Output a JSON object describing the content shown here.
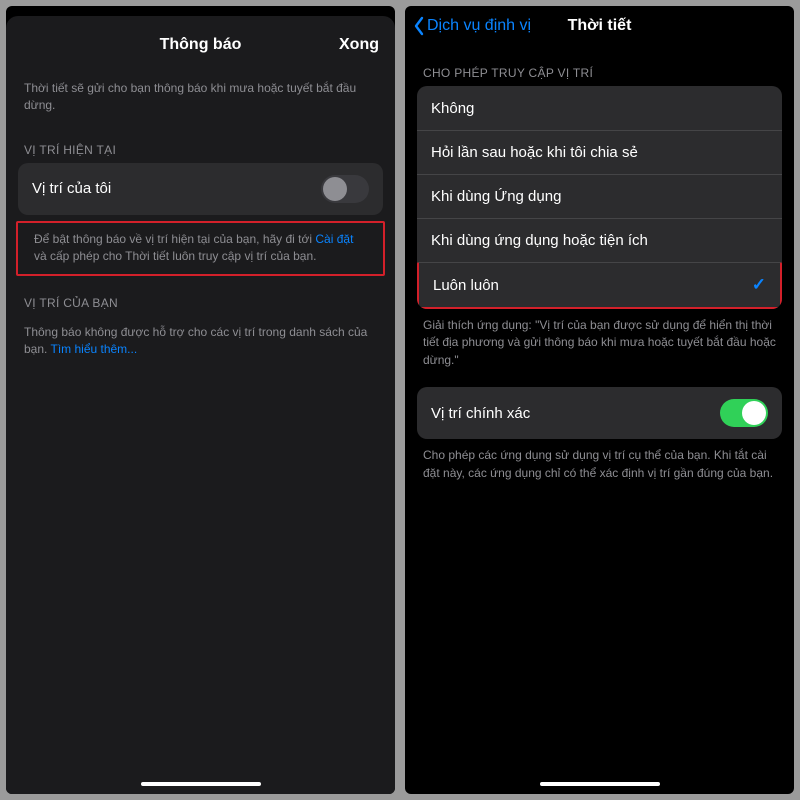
{
  "left": {
    "header": {
      "title": "Thông báo",
      "done": "Xong"
    },
    "intro": "Thời tiết sẽ gửi cho bạn thông báo khi mưa hoặc tuyết bắt đầu dừng.",
    "section_current": "VỊ TRÍ HIỆN TẠI",
    "my_location_label": "Vị trí của tôi",
    "hint_pre": "Để bật thông báo về vị trí hiện tại của bạn, hãy đi tới ",
    "hint_link": "Cài đặt",
    "hint_post": " và cấp phép cho Thời tiết luôn truy cập vị trí của bạn.",
    "section_your": "VỊ TRÍ CỦA BẠN",
    "unsupported_pre": "Thông báo không được hỗ trợ cho các vị trí trong danh sách của bạn. ",
    "unsupported_link": "Tìm hiểu thêm..."
  },
  "right": {
    "back": "Dịch vụ định vị",
    "title": "Thời tiết",
    "section_allow": "CHO PHÉP TRUY CẬP VỊ TRÍ",
    "options": [
      {
        "label": "Không",
        "selected": false
      },
      {
        "label": "Hỏi lần sau hoặc khi tôi chia sẻ",
        "selected": false
      },
      {
        "label": "Khi dùng Ứng dụng",
        "selected": false
      },
      {
        "label": "Khi dùng ứng dụng hoặc tiện ích",
        "selected": false
      },
      {
        "label": "Luôn luôn",
        "selected": true
      }
    ],
    "explain": "Giải thích ứng dụng: \"Vị trí của bạn được sử dụng để hiển thị thời tiết địa phương và gửi thông báo khi mưa hoặc tuyết bắt đầu hoặc dừng.\"",
    "precise_label": "Vị trí chính xác",
    "precise_desc": "Cho phép các ứng dụng sử dụng vị trí cụ thể của bạn. Khi tắt cài đặt này, các ứng dụng chỉ có thể xác định vị trí gần đúng của bạn."
  }
}
